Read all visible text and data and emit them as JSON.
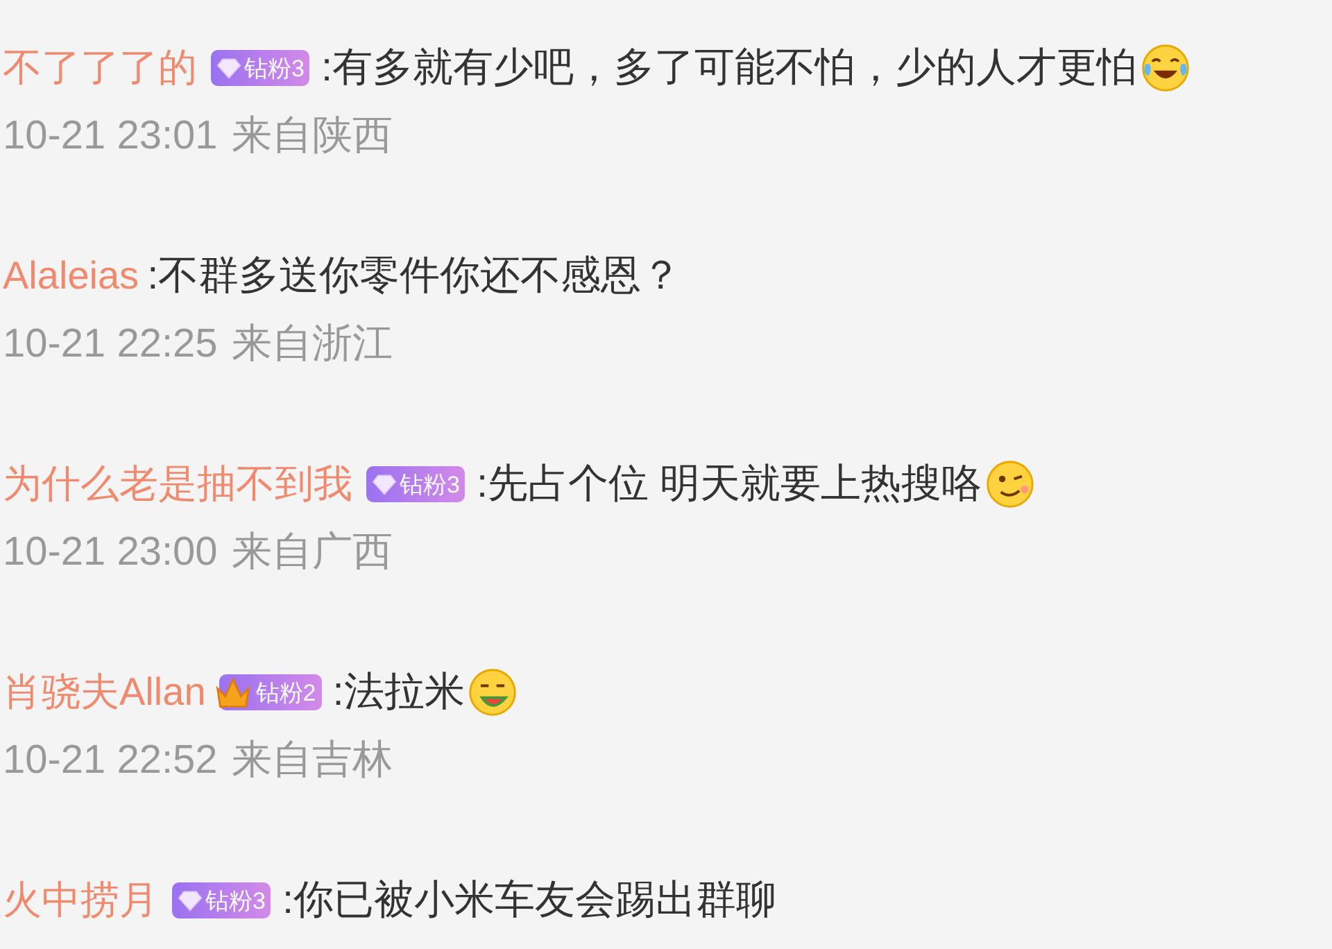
{
  "comments": [
    {
      "username": "不了了了的",
      "badge": {
        "kind": "diamond",
        "label": "钻粉3"
      },
      "text": ":有多就有少吧，多了可能不怕，少的人才更怕",
      "emoji": {
        "kind": "laugh-cry"
      },
      "time": "10-21 23:01",
      "location": "来自陕西"
    },
    {
      "username": "Alaleias",
      "text": ":不群多送你零件你还不感恩？",
      "time": "10-21 22:25",
      "location": "来自浙江"
    },
    {
      "username": "为什么老是抽不到我",
      "badge": {
        "kind": "diamond",
        "label": "钻粉3"
      },
      "text": ":先占个位 明天就要上热搜咯",
      "emoji": {
        "kind": "wink"
      },
      "time": "10-21 23:00",
      "location": "来自广西"
    },
    {
      "username": "肖骁夫Allan",
      "badge": {
        "kind": "crown",
        "label": "钻粉2"
      },
      "text": ":法拉米",
      "emoji": {
        "kind": "watermelon"
      },
      "time": "10-21 22:52",
      "location": "来自吉林"
    },
    {
      "username": "火中捞月",
      "badge": {
        "kind": "diamond",
        "label": "钻粉3"
      },
      "text": ":你已被小米车友会踢出群聊"
    }
  ]
}
